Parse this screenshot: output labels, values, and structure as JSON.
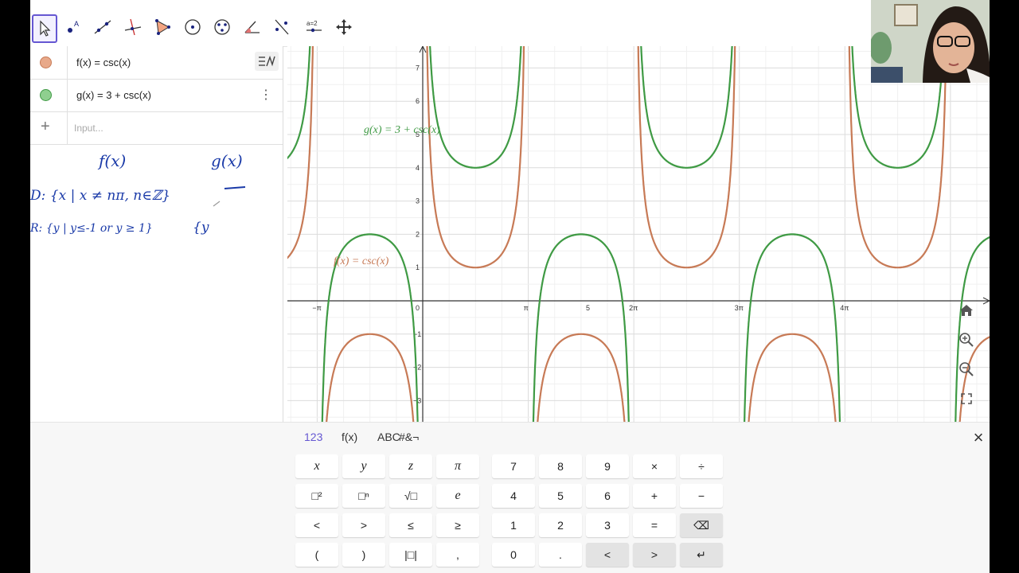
{
  "algebra": {
    "rows": [
      {
        "expr": "f(x) = csc(x)",
        "color": "#c77a56"
      },
      {
        "expr": "g(x) = 3 + csc(x)",
        "color": "#3f9a44"
      }
    ],
    "input_placeholder": "Input...",
    "plus": "+",
    "menu_icon": "⋮"
  },
  "graph": {
    "f_label": "f(x) = csc(x)",
    "g_label": "g(x) = 3 + csc(x)",
    "x_ticks": [
      "−π",
      "0",
      "π",
      "2π",
      "3π",
      "4π",
      "5"
    ],
    "y_ticks": [
      "7",
      "6",
      "5",
      "4",
      "3",
      "2",
      "1",
      "−1",
      "−2",
      "−3"
    ],
    "colors": {
      "f": "#c77a56",
      "g": "#3f9a44"
    }
  },
  "handwriting": {
    "col_f": "f(x)",
    "col_g": "g(x)",
    "domain": "D: {x | x ≠ nπ, n∈ℤ}",
    "range": "R: {y | y≤-1 or y ≥ 1}",
    "partial": "{y"
  },
  "keyboard": {
    "tabs": [
      "123",
      "f(x)",
      "ABC",
      "#&¬"
    ],
    "close": "×",
    "left_keys": [
      [
        "x",
        "y",
        "z",
        "π"
      ],
      [
        "□²",
        "□ⁿ",
        "√□",
        "e"
      ],
      [
        "<",
        ">",
        "≤",
        "≥"
      ],
      [
        "(",
        ")",
        "|□|",
        ","
      ]
    ],
    "right_keys": [
      [
        "7",
        "8",
        "9",
        "×",
        "÷"
      ],
      [
        "4",
        "5",
        "6",
        "+",
        "−"
      ],
      [
        "1",
        "2",
        "3",
        "=",
        "⌫"
      ],
      [
        "0",
        ".",
        "<",
        ">",
        "↵"
      ]
    ]
  }
}
